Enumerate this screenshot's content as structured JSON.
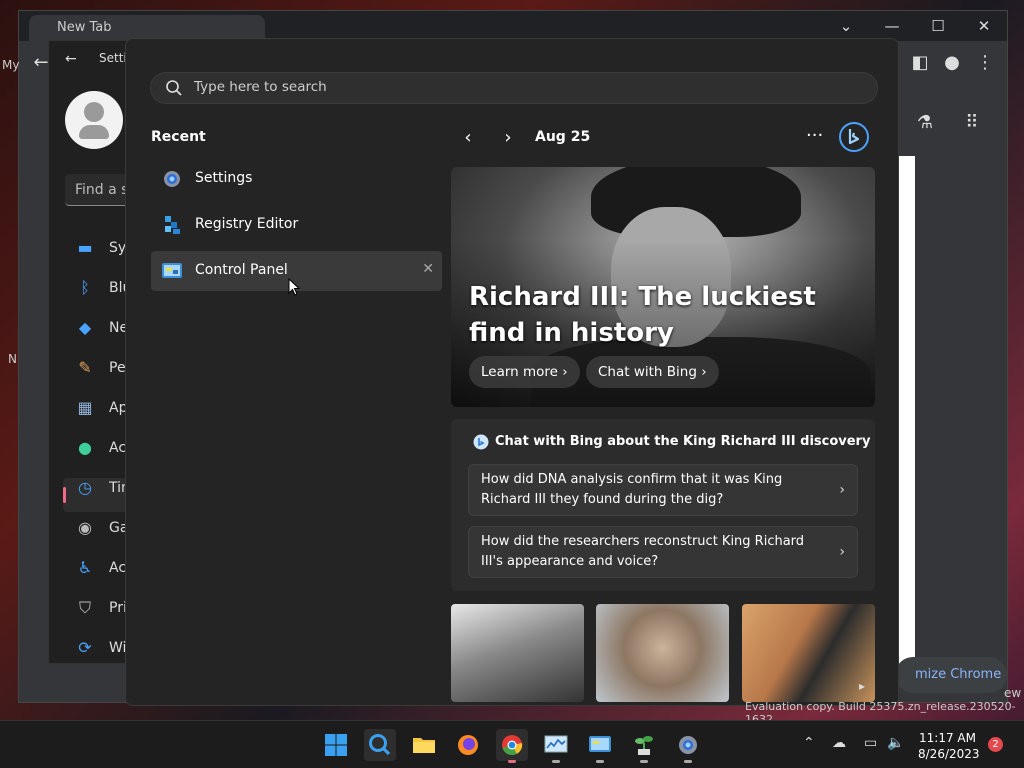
{
  "chrome": {
    "tab_title": "New Tab",
    "customize_label": "mize Chrome"
  },
  "desktop": {
    "edge_label_left_1": "My",
    "edge_label_left_2": "N",
    "edge_label_right": "ew",
    "eval_text": "Evaluation copy. Build 25375.zn_release.230520-1632"
  },
  "settings": {
    "title": "Settin",
    "find_placeholder": "Find a se",
    "items": [
      {
        "label": "Sys",
        "icon": "system-icon"
      },
      {
        "label": "Blu",
        "icon": "bluetooth-icon"
      },
      {
        "label": "Ne",
        "icon": "network-icon"
      },
      {
        "label": "Per",
        "icon": "personalization-icon"
      },
      {
        "label": "Ap",
        "icon": "apps-icon"
      },
      {
        "label": "Ac",
        "icon": "accounts-icon"
      },
      {
        "label": "Tin",
        "icon": "time-language-icon"
      },
      {
        "label": "Ga",
        "icon": "gaming-icon"
      },
      {
        "label": "Ac",
        "icon": "accessibility-icon"
      },
      {
        "label": "Pri",
        "icon": "privacy-icon"
      },
      {
        "label": "Wi",
        "icon": "windows-update-icon"
      }
    ]
  },
  "start": {
    "search_placeholder": "Type here to search",
    "recent_heading": "Recent",
    "recent": [
      {
        "label": "Settings",
        "icon": "settings-gear-icon"
      },
      {
        "label": "Registry Editor",
        "icon": "registry-editor-icon"
      },
      {
        "label": "Control Panel",
        "icon": "control-panel-icon"
      }
    ],
    "remove_glyph": "✕",
    "date": "Aug 25",
    "more_glyph": "···",
    "hero": {
      "title": "Richard III: The luckiest find in history",
      "learn_more": "Learn more",
      "chat_with_bing": "Chat with Bing"
    },
    "chat": {
      "heading": "Chat with Bing about the King Richard III discovery",
      "questions": [
        "How did DNA analysis confirm that it was King Richard III they found during the dig?",
        "How did the researchers reconstruct King Richard III's appearance and voice?"
      ]
    }
  },
  "taskbar": {
    "time": "11:17 AM",
    "date": "8/26/2023",
    "notification_count": "2"
  }
}
